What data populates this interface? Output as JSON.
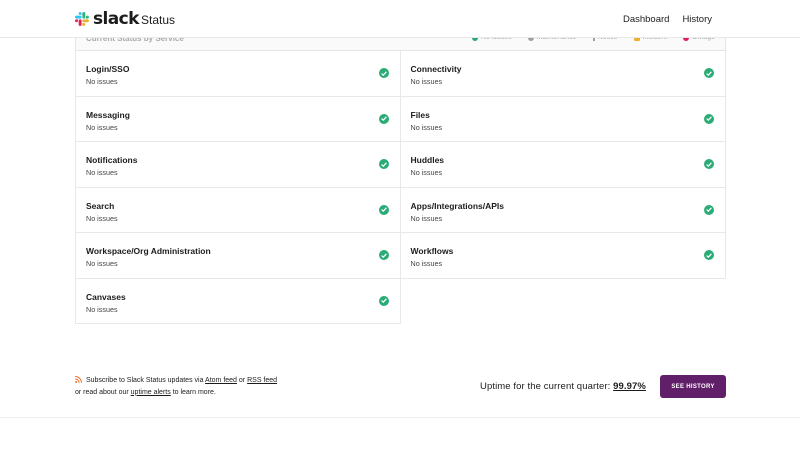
{
  "header": {
    "logo_text": "slack",
    "page_name": "Status",
    "nav": [
      {
        "label": "Dashboard"
      },
      {
        "label": "History"
      }
    ]
  },
  "grid": {
    "title": "Current Status by Service",
    "legend": [
      {
        "label": "No issues",
        "color": "#2bac76"
      },
      {
        "label": "Maintenance",
        "color": "#9e9ea6"
      },
      {
        "label": "Notice",
        "color": "#9e9ea6"
      },
      {
        "label": "Incident",
        "color": "#ecb22e"
      },
      {
        "label": "Outage",
        "color": "#e01e5a"
      }
    ],
    "left": [
      {
        "name": "Login/SSO",
        "status": "No issues"
      },
      {
        "name": "Messaging",
        "status": "No issues"
      },
      {
        "name": "Notifications",
        "status": "No issues"
      },
      {
        "name": "Search",
        "status": "No issues"
      },
      {
        "name": "Workspace/Org Administration",
        "status": "No issues"
      },
      {
        "name": "Canvases",
        "status": "No issues"
      }
    ],
    "right": [
      {
        "name": "Connectivity",
        "status": "No issues"
      },
      {
        "name": "Files",
        "status": "No issues"
      },
      {
        "name": "Huddles",
        "status": "No issues"
      },
      {
        "name": "Apps/Integrations/APIs",
        "status": "No issues"
      },
      {
        "name": "Workflows",
        "status": "No issues"
      }
    ]
  },
  "footer": {
    "subscribe_prefix": "Subscribe to Slack Status updates via",
    "atom_link": "Atom feed",
    "or1": "or",
    "rss_link": "RSS feed",
    "line2_prefix": "or read about our",
    "uptime_link": "uptime alerts",
    "line2_suffix": "to learn more.",
    "uptime_label": "Uptime for the current quarter:",
    "uptime_value": "99.97%",
    "history_button": "SEE HISTORY"
  },
  "colors": {
    "accent": "#611f69",
    "ok": "#2bac76"
  }
}
